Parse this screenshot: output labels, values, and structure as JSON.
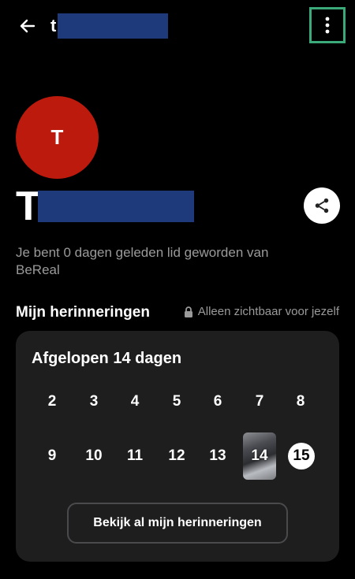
{
  "header": {
    "username_visible": "t"
  },
  "profile": {
    "avatar_initial": "T",
    "name_visible": "T",
    "member_since_text": "Je bent 0 dagen geleden lid geworden van BeReal"
  },
  "memories": {
    "title": "Mijn herinneringen",
    "privacy_label": "Alleen zichtbaar voor jezelf",
    "card_title": "Afgelopen 14 dagen",
    "week1": [
      "2",
      "3",
      "4",
      "5",
      "6",
      "7",
      "8"
    ],
    "week2": [
      "9",
      "10",
      "11",
      "12",
      "13",
      "14",
      "15"
    ],
    "view_all_label": "Bekijk al mijn herinneringen"
  },
  "colors": {
    "avatar_bg": "#bb1a0c",
    "highlight_border": "#3aaa7a",
    "redaction": "#1f3a7a"
  }
}
